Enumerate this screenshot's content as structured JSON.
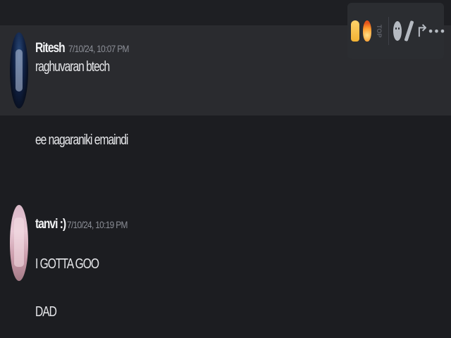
{
  "messages": [
    {
      "author": "Ritesh",
      "timestamp": "7/10/24, 10:07 PM",
      "avatar": "avatar-ritesh",
      "lines": [
        "raghuvaran btech",
        "ee nagaraniki emaindi"
      ]
    },
    {
      "author": "tanvi :)",
      "timestamp": "7/10/24, 10:19 PM",
      "avatar": "avatar-tanvi",
      "lines": [
        "I GOTTA GOO",
        "DAD"
      ]
    }
  ],
  "toolbar": {
    "reactions": [
      "thumbs-up-emoji",
      "fire-emoji",
      "top-emoji"
    ],
    "top_label": "TOP",
    "actions": [
      "add-reaction-icon",
      "edit-icon",
      "reply-icon",
      "more-icon"
    ],
    "reply_glyph": "↱",
    "more_glyph": "•••"
  },
  "colors": {
    "background": "#1c1d21",
    "hover_background": "#2a2b2f",
    "toolbar_background": "#2b2d31",
    "text": "#e6e7ea",
    "muted": "#8b8e96"
  }
}
